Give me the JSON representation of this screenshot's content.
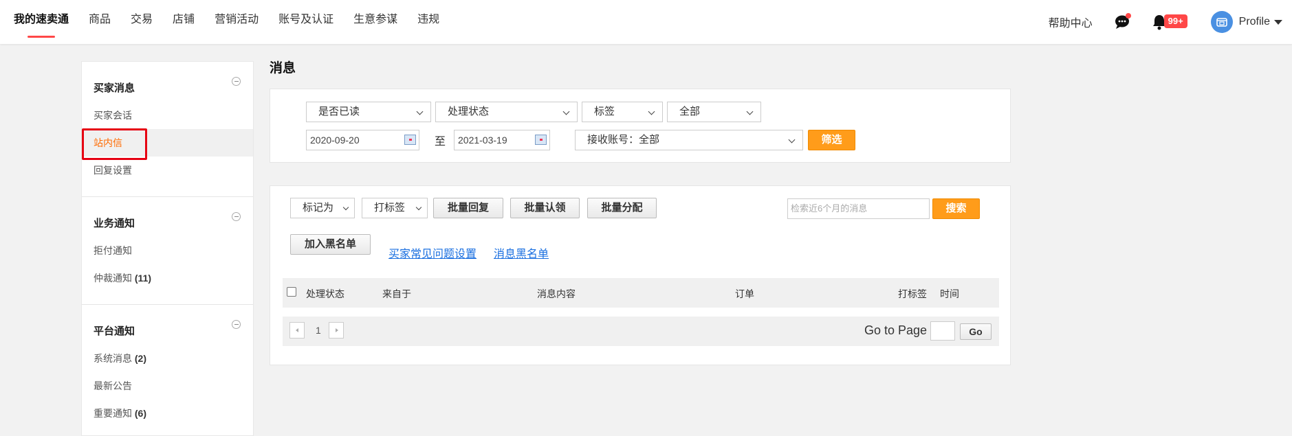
{
  "topnav": {
    "items": [
      "我的速卖通",
      "商品",
      "交易",
      "店铺",
      "营销活动",
      "账号及认证",
      "生意参谋",
      "违规"
    ],
    "help": "帮助中心",
    "notification_badge": "99+",
    "profile": "Profile"
  },
  "sidebar": {
    "sections": [
      {
        "title": "买家消息",
        "items": [
          {
            "label": "买家会话",
            "count": ""
          },
          {
            "label": "站内信",
            "count": ""
          },
          {
            "label": "回复设置",
            "count": ""
          }
        ]
      },
      {
        "title": "业务通知",
        "items": [
          {
            "label": "拒付通知",
            "count": ""
          },
          {
            "label": "仲裁通知",
            "count": "(11)"
          }
        ]
      },
      {
        "title": "平台通知",
        "items": [
          {
            "label": "系统消息",
            "count": "(2)"
          },
          {
            "label": "最新公告",
            "count": ""
          },
          {
            "label": "重要通知",
            "count": "(6)"
          }
        ]
      }
    ],
    "selected": "站内信"
  },
  "page_title": "消息",
  "filters": {
    "read_status": "是否已读",
    "process_status": "处理状态",
    "tag": "标签",
    "all": "全部",
    "date_from": "2020-09-20",
    "to_label": "至",
    "date_to": "2021-03-19",
    "account": "接收账号：全部",
    "filter_button": "筛选"
  },
  "toolbar": {
    "mark_as": "标记为",
    "tag_action": "打标签",
    "batch_reply": "批量回复",
    "batch_claim": "批量认领",
    "batch_assign": "批量分配",
    "search_placeholder": "检索近6个月的消息",
    "search_button": "搜索",
    "add_blacklist": "加入黑名单",
    "faq_link": "买家常见问题设置",
    "blacklist_link": "消息黑名单"
  },
  "table": {
    "headers": [
      "处理状态",
      "来自于",
      "消息内容",
      "订单",
      "打标签",
      "时间"
    ]
  },
  "pager": {
    "current_page": "1",
    "goto_label": "Go to Page",
    "go_button": "Go"
  }
}
